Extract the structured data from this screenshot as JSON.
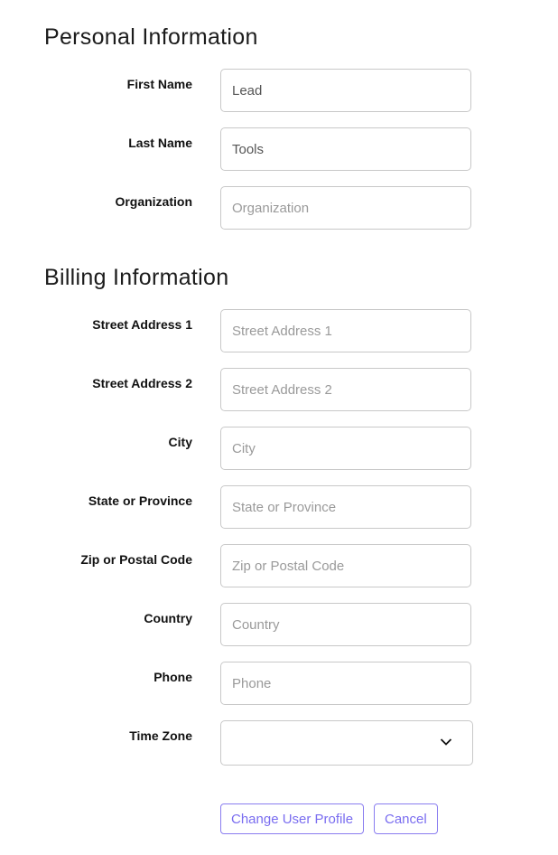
{
  "personal": {
    "title": "Personal Information",
    "fields": [
      {
        "label": "First Name",
        "value": "Lead",
        "placeholder": "First Name"
      },
      {
        "label": "Last Name",
        "value": "Tools",
        "placeholder": "Last Name"
      },
      {
        "label": "Organization",
        "value": "",
        "placeholder": "Organization"
      }
    ]
  },
  "billing": {
    "title": "Billing Information",
    "fields": [
      {
        "label": "Street Address 1",
        "value": "",
        "placeholder": "Street Address 1"
      },
      {
        "label": "Street Address 2",
        "value": "",
        "placeholder": "Street Address 2"
      },
      {
        "label": "City",
        "value": "",
        "placeholder": "City"
      },
      {
        "label": "State or Province",
        "value": "",
        "placeholder": "State or Province"
      },
      {
        "label": "Zip or Postal Code",
        "value": "",
        "placeholder": "Zip or Postal Code"
      },
      {
        "label": "Country",
        "value": "",
        "placeholder": "Country"
      },
      {
        "label": "Phone",
        "value": "",
        "placeholder": "Phone"
      }
    ],
    "timezone": {
      "label": "Time Zone",
      "value": "",
      "icon": "chevron-down-icon"
    }
  },
  "actions": {
    "submit_label": "Change User Profile",
    "cancel_label": "Cancel",
    "accent": "#7a6df0"
  }
}
